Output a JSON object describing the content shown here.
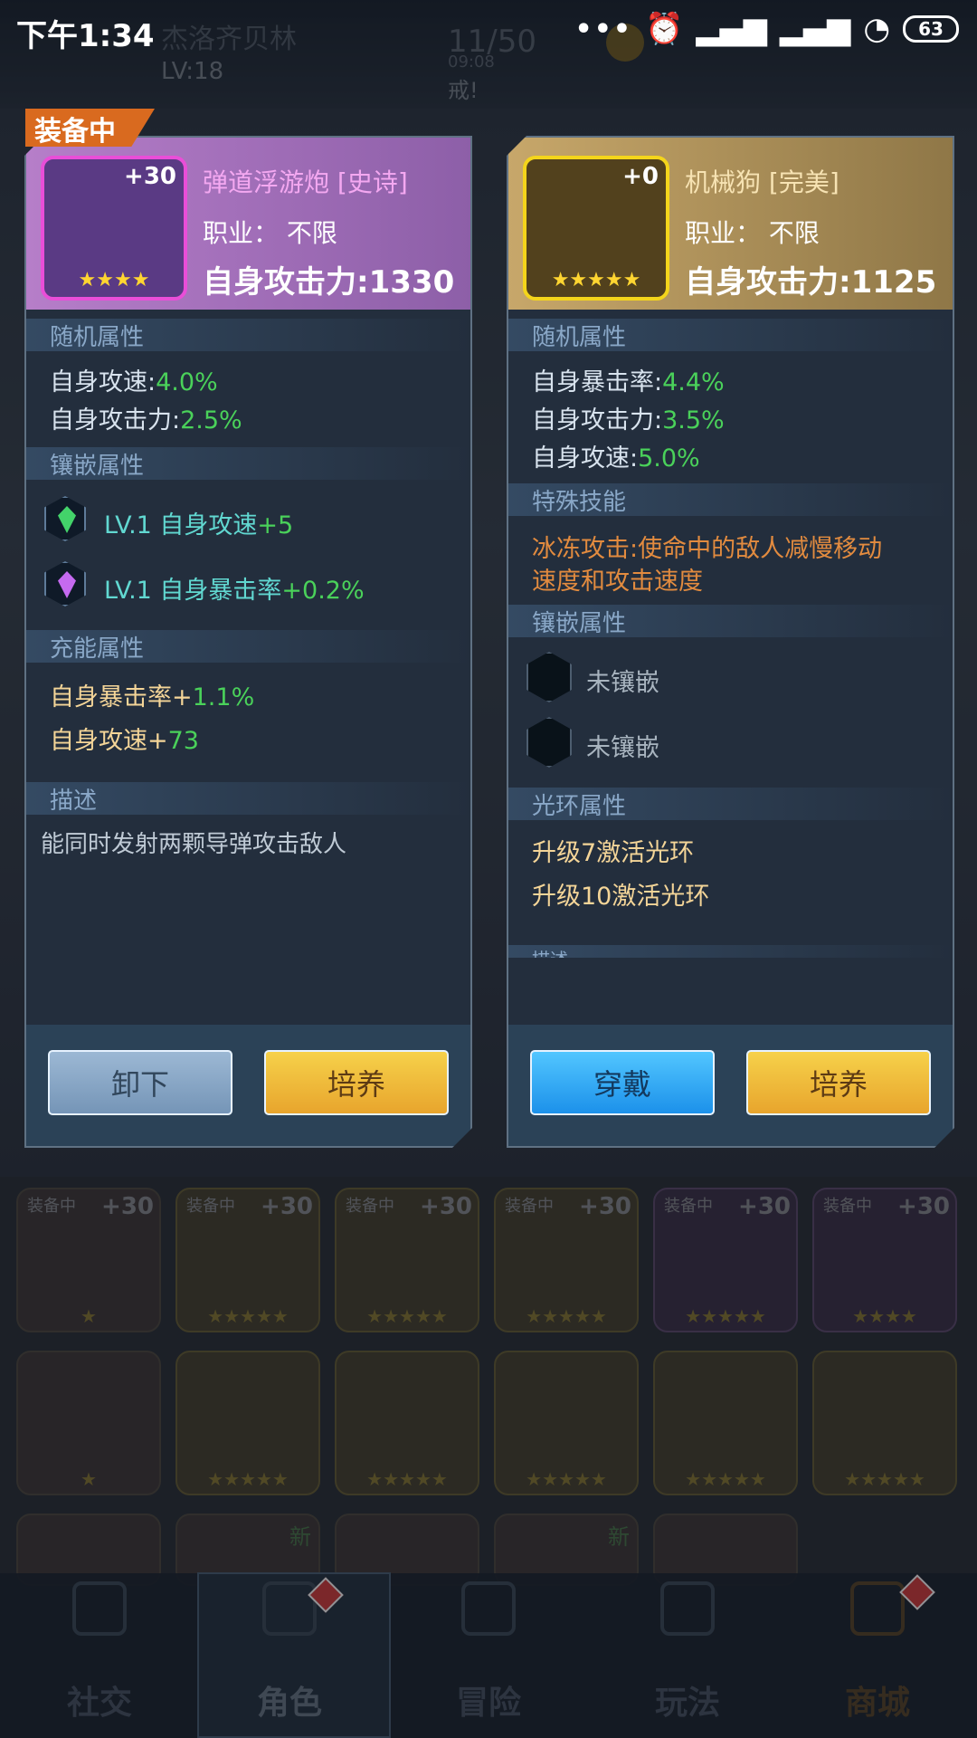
{
  "status": {
    "time": "下午1:34",
    "battery": "63"
  },
  "background": {
    "player_name": "杰洛齐贝林",
    "level": "LV:18",
    "energy": "11/50",
    "energy_timer": "09:08",
    "note": "戒!"
  },
  "equip_tag": "装备中",
  "left_item": {
    "plus": "+30",
    "stars": "★★★★",
    "name": "弹道浮游炮",
    "quality": "[史诗]",
    "job": "职业：  不限",
    "attack": "自身攻击力:1330",
    "sections": {
      "random": "随机属性",
      "r1_label": "自身攻速:",
      "r1_val": "4.0%",
      "r2_label": "自身攻击力:",
      "r2_val": "2.5%",
      "inlay": "镶嵌属性",
      "g1_level": "LV.1",
      "g1_label": "自身攻速",
      "g1_val": "+5",
      "g2_level": "LV.1",
      "g2_label": "自身暴击率",
      "g2_val": "+0.2%",
      "charge": "充能属性",
      "c1_label": "自身暴击率+",
      "c1_val": "1.1%",
      "c2_label": "自身攻速+",
      "c2_val": "73",
      "desc": "描述",
      "desc_text": "能同时发射两颗导弹攻击敌人"
    },
    "buttons": {
      "unequip": "卸下",
      "train": "培养"
    }
  },
  "right_item": {
    "plus": "+0",
    "stars": "★★★★★",
    "name": "机械狗",
    "quality": "[完美]",
    "job": "职业：  不限",
    "attack": "自身攻击力:1125",
    "sections": {
      "random": "随机属性",
      "r1_label": "自身暴击率:",
      "r1_val": "4.4%",
      "r2_label": "自身攻击力:",
      "r2_val": "3.5%",
      "r3_label": "自身攻速:",
      "r3_val": "5.0%",
      "skill": "特殊技能",
      "skill_text1": "冰冻攻击:使命中的敌人减慢移动",
      "skill_text2": "速度和攻击速度",
      "inlay": "镶嵌属性",
      "empty1": "未镶嵌",
      "empty2": "未镶嵌",
      "aura": "光环属性",
      "a1": "升级7激活光环",
      "a2": "升级10激活光环",
      "desc": "描述"
    },
    "buttons": {
      "equip": "穿戴",
      "train": "培养"
    }
  },
  "grid": {
    "equipped": "装备中",
    "plus": "+30",
    "new": "新",
    "stars5": "★★★★★",
    "stars4": "★★★★",
    "stars1": "★"
  },
  "nav": {
    "social": "社交",
    "role": "角色",
    "adventure": "冒险",
    "play": "玩法",
    "shop": "商城"
  }
}
